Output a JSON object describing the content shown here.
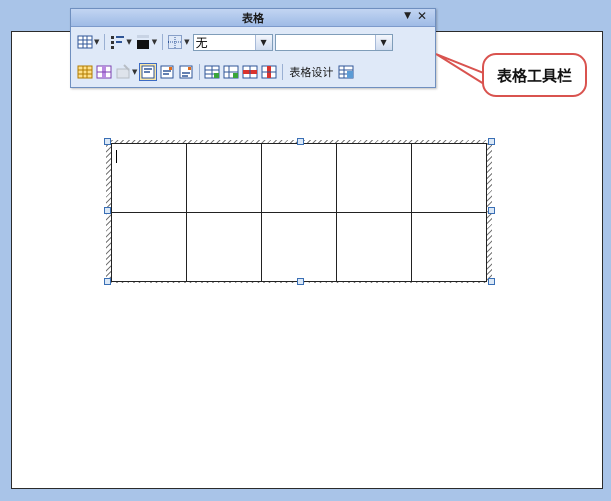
{
  "toolbar": {
    "title": "表格",
    "menu_glyph": "▼",
    "close_glyph": "✕",
    "border_style_value": "无",
    "border_width_value": "",
    "design_label": "表格设计",
    "dropdown_glyph": "▼"
  },
  "callout": {
    "text": "表格工具栏"
  },
  "table": {
    "rows": 2,
    "cols": 5
  },
  "colors": {
    "accent": "#3c6bc4",
    "callout_border": "#d9534f",
    "background": "#a9c4e8"
  }
}
